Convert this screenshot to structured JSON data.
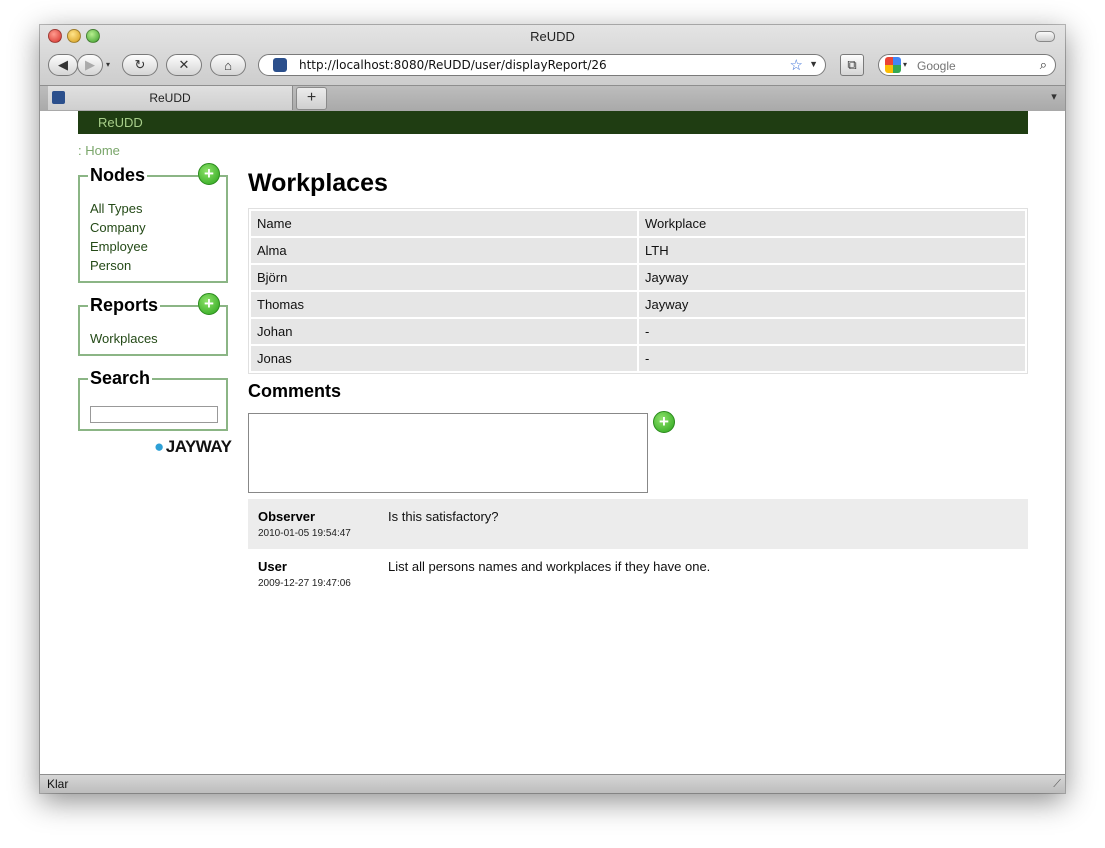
{
  "browser": {
    "window_title": "ReUDD",
    "url": "http://localhost:8080/ReUDD/user/displayReport/26",
    "search_placeholder": "Google",
    "tab_title": "ReUDD",
    "new_tab_label": "+",
    "status_text": "Klar"
  },
  "site": {
    "brand": "ReUDD",
    "breadcrumb": ": Home"
  },
  "sidebar": {
    "nodes": {
      "title": "Nodes",
      "items": [
        "All Types",
        "Company",
        "Employee",
        "Person"
      ]
    },
    "reports": {
      "title": "Reports",
      "items": [
        "Workplaces"
      ]
    },
    "search": {
      "title": "Search",
      "value": ""
    },
    "logo_text": "JAYWAY"
  },
  "report": {
    "title": "Workplaces",
    "columns": [
      "Name",
      "Workplace"
    ],
    "rows": [
      [
        "Alma",
        "LTH"
      ],
      [
        "Björn",
        "Jayway"
      ],
      [
        "Thomas",
        "Jayway"
      ],
      [
        "Johan",
        "-"
      ],
      [
        "Jonas",
        "-"
      ]
    ]
  },
  "comments": {
    "title": "Comments",
    "new_comment": "",
    "items": [
      {
        "author": "Observer",
        "date": "2010-01-05 19:54:47",
        "text": "Is this satisfactory?"
      },
      {
        "author": "User",
        "date": "2009-12-27 19:47:06",
        "text": "List all persons names and workplaces if they have one."
      }
    ]
  },
  "icons": {
    "add": "plus-circle-icon",
    "back": "back-arrow-icon",
    "forward": "forward-arrow-icon",
    "reload": "reload-icon",
    "stop": "stop-icon",
    "home": "home-icon",
    "bookmark": "star-icon",
    "search": "magnifier-icon"
  },
  "colors": {
    "site_bar": "#1f3d12",
    "link": "#244a17",
    "box_border": "#8bb585",
    "add_button": "#29a31a"
  }
}
